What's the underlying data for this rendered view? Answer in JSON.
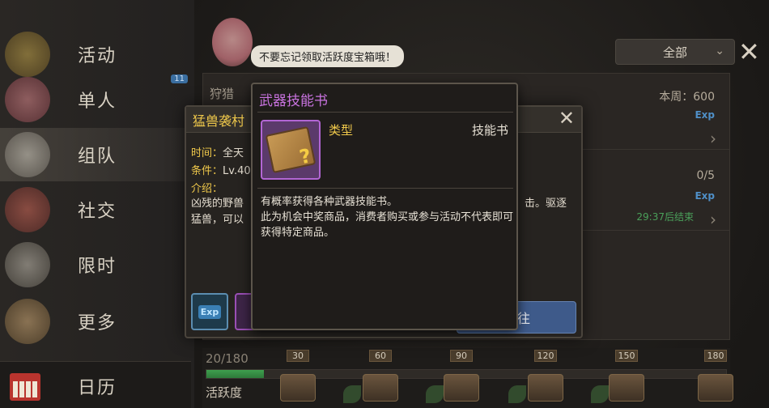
{
  "sidebar": {
    "items": [
      {
        "label": "活动",
        "badge": ""
      },
      {
        "label": "单人",
        "badge": "11"
      },
      {
        "label": "组队",
        "badge": ""
      },
      {
        "label": "社交",
        "badge": ""
      },
      {
        "label": "限时",
        "badge": ""
      },
      {
        "label": "更多",
        "badge": ""
      }
    ],
    "calendar_label": "日历"
  },
  "hint": "不要忘记领取活跃度宝箱哦！",
  "filter": {
    "value": "全部",
    "chevron": "chevron-down-icon"
  },
  "list": {
    "rows": [
      {
        "title": "狩猎",
        "week": "本周：600",
        "exp": "Exp",
        "timer": ""
      },
      {
        "title": "",
        "week": "0/5",
        "exp": "Exp",
        "timer": "29:37后结束"
      }
    ]
  },
  "event": {
    "title": "猛兽袭村",
    "time_k": "时间：",
    "time_v": "全天",
    "cond_k": "条件：",
    "cond_v": "Lv.40",
    "intro_k": "介绍：",
    "desc_line1": "凶残的野兽",
    "desc_tail": "击。驱逐",
    "desc_line2": "猛兽，可以",
    "go_label": "往",
    "exp_chip": "Exp"
  },
  "tooltip": {
    "title": "武器技能书",
    "type_key": "类型",
    "type_value": "技能书",
    "desc1": "有概率获得各种武器技能书。",
    "desc2": "此为机会中奖商品，消费者购买或参与活动不代表即可获得特定商品。"
  },
  "activity": {
    "progress_text": "20/180",
    "progress_fraction": 0.111,
    "label": "活跃度",
    "milestones": [
      "30",
      "60",
      "90",
      "120",
      "150",
      "180"
    ]
  }
}
